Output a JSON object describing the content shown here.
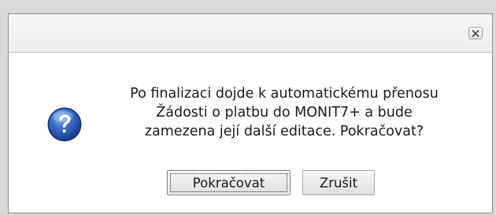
{
  "dialog": {
    "close_icon": "close-x-icon",
    "question_icon": "question-icon",
    "message_lines": [
      "Po finalizaci dojde k automatickému přenosu",
      "Žádosti o platbu do MONIT7+ a bude",
      "zamezena její další editace. Pokračovat?"
    ],
    "confirm_label": "Pokračovat",
    "cancel_label": "Zrušit",
    "colors": {
      "icon_blue": "#1f4fa8",
      "icon_highlight": "#7fa8e8",
      "dialog_bg": "#ffffff",
      "titlebar_bg": "#efefef"
    }
  }
}
